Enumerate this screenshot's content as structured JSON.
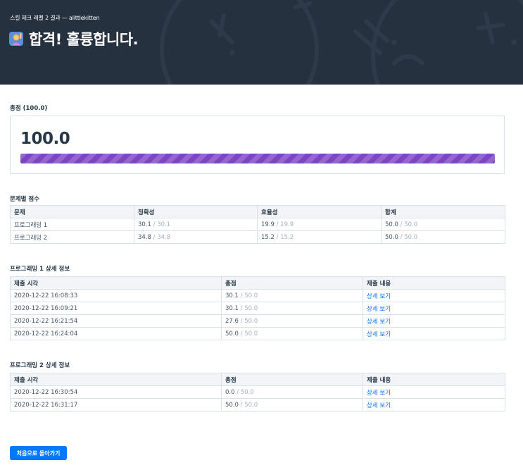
{
  "header": {
    "subtitle": "스킬 체크 레벨 2 결과 — alittlekitten",
    "title": "합격! 훌륭합니다.",
    "emoji_icon": "person-raising-hand-icon"
  },
  "total": {
    "label": "총점 (100.0)",
    "value": "100.0",
    "progress_fraction": 1.0,
    "bar_color": "#7d45c4"
  },
  "problem_scores": {
    "label": "문제별 점수",
    "columns": [
      "문제",
      "정확성",
      "효율성",
      "합계"
    ],
    "rows": [
      {
        "name": "프로그래밍 1",
        "accuracy": "30.1",
        "accuracy_max": "30.1",
        "efficiency": "19.9",
        "efficiency_max": "19.9",
        "total": "50.0",
        "total_max": "50.0"
      },
      {
        "name": "프로그래밍 2",
        "accuracy": "34.8",
        "accuracy_max": "34.8",
        "efficiency": "15.2",
        "efficiency_max": "15.2",
        "total": "50.0",
        "total_max": "50.0"
      }
    ]
  },
  "details": [
    {
      "label": "프로그래밍 1 상세 정보",
      "columns": [
        "제출 시각",
        "총점",
        "제출 내용"
      ],
      "rows": [
        {
          "time": "2020-12-22 16:08:33",
          "score": "30.1",
          "max": "50.0",
          "link": "상세 보기"
        },
        {
          "time": "2020-12-22 16:09:21",
          "score": "30.1",
          "max": "50.0",
          "link": "상세 보기"
        },
        {
          "time": "2020-12-22 16:21:54",
          "score": "27.6",
          "max": "50.0",
          "link": "상세 보기"
        },
        {
          "time": "2020-12-22 16:24:04",
          "score": "50.0",
          "max": "50.0",
          "link": "상세 보기"
        }
      ]
    },
    {
      "label": "프로그래밍 2 상세 정보",
      "columns": [
        "제출 시각",
        "총점",
        "제출 내용"
      ],
      "rows": [
        {
          "time": "2020-12-22 16:30:54",
          "score": "0.0",
          "max": "50.0",
          "link": "상세 보기"
        },
        {
          "time": "2020-12-22 16:31:17",
          "score": "50.0",
          "max": "50.0",
          "link": "상세 보기"
        }
      ]
    }
  ],
  "back_button": {
    "label": "처음으로 돌아가기"
  },
  "colors": {
    "header_bg": "#263140",
    "accent": "#0078ff",
    "muted": "#a3b1c2"
  }
}
